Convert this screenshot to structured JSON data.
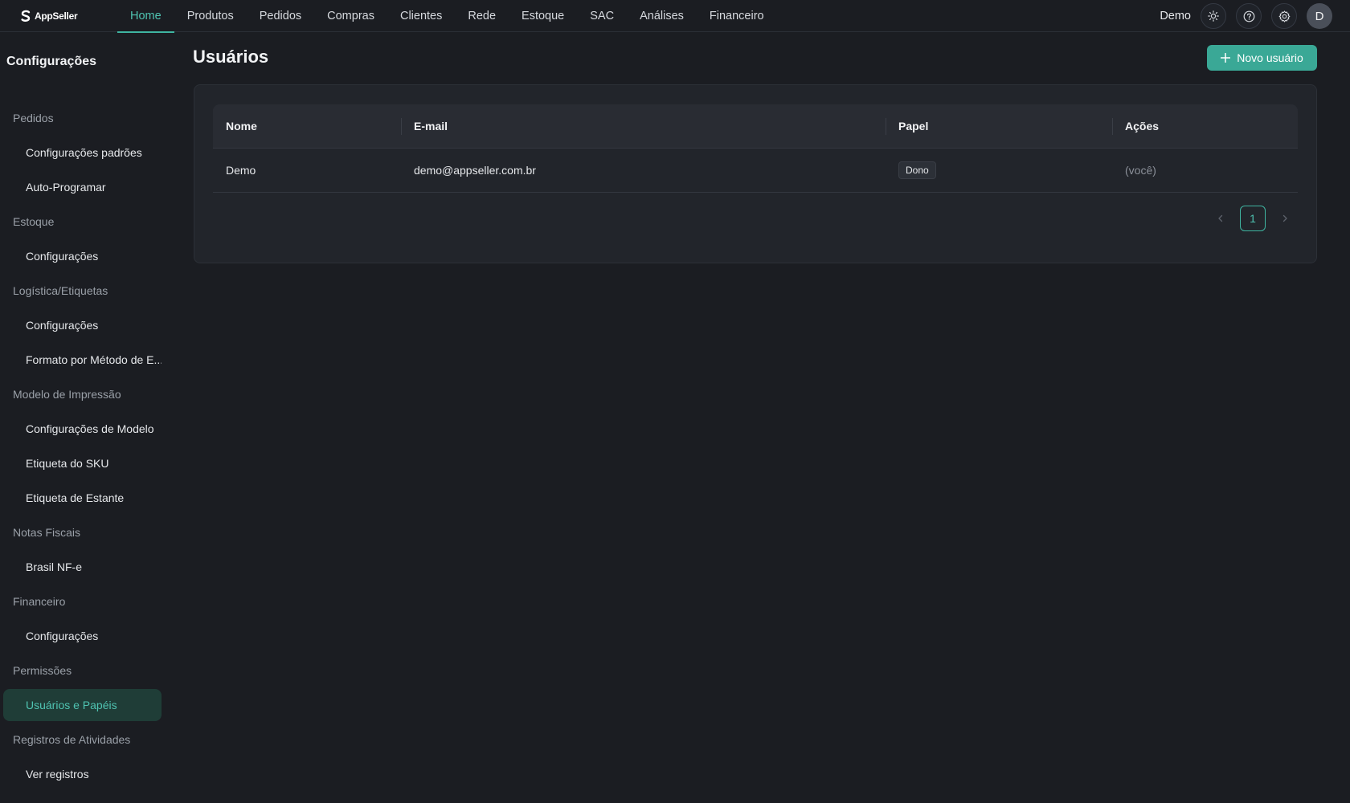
{
  "app": {
    "logo_text": "AppSeller"
  },
  "nav": {
    "items": [
      "Home",
      "Produtos",
      "Pedidos",
      "Compras",
      "Clientes",
      "Rede",
      "Estoque",
      "SAC",
      "Análises",
      "Financeiro"
    ],
    "active": "Home"
  },
  "header": {
    "user_name": "Demo",
    "avatar_initial": "D",
    "icons": [
      "sun-icon",
      "help-icon",
      "gear-icon"
    ]
  },
  "sidebar": {
    "title": "Configurações",
    "groups": [
      {
        "label": "Pedidos",
        "items": [
          "Configurações padrões",
          "Auto-Programar"
        ]
      },
      {
        "label": "Estoque",
        "items": [
          "Configurações"
        ]
      },
      {
        "label": "Logística/Etiquetas",
        "items": [
          "Configurações",
          "Formato por Método de E..."
        ]
      },
      {
        "label": "Modelo de Impressão",
        "items": [
          "Configurações de Modelo",
          "Etiqueta do SKU",
          "Etiqueta de Estante"
        ]
      },
      {
        "label": "Notas Fiscais",
        "items": [
          "Brasil NF-e"
        ]
      },
      {
        "label": "Financeiro",
        "items": [
          "Configurações"
        ]
      },
      {
        "label": "Permissões",
        "items": [
          "Usuários e Papéis"
        ]
      },
      {
        "label": "Registros de Atividades",
        "items": [
          "Ver registros"
        ]
      }
    ],
    "active_item": "Usuários e Papéis"
  },
  "main": {
    "title": "Usuários",
    "new_button_label": "Novo usuário",
    "table": {
      "columns": [
        "Nome",
        "E-mail",
        "Papel",
        "Ações"
      ],
      "rows": [
        {
          "name": "Demo",
          "email": "demo@appseller.com.br",
          "role": "Dono",
          "actions": "(você)"
        }
      ]
    },
    "pagination": {
      "current_page": "1"
    }
  },
  "colors": {
    "accent": "#3aa896",
    "background": "#1b1d22",
    "card": "#22252b"
  }
}
